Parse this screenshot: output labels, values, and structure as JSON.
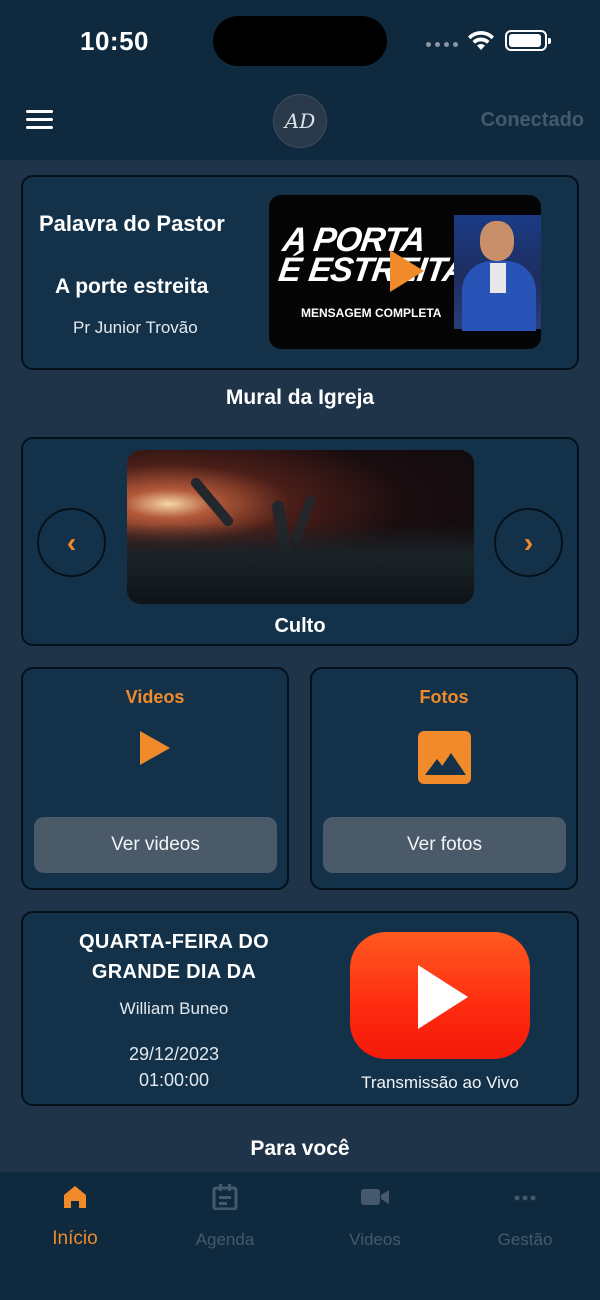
{
  "status_bar": {
    "time": "10:50"
  },
  "header": {
    "logo_text": "AD",
    "connection_status": "Conectado"
  },
  "pastor_card": {
    "title": "Palavra do Pastor",
    "sermon_title": "A porte estreita",
    "pastor_name": "Pr Junior Trovão",
    "thumbnail_headline_1": "A PORTA",
    "thumbnail_headline_2": "É ESTREITA",
    "thumbnail_caption": "MENSAGEM COMPLETA"
  },
  "mural": {
    "section_title": "Mural da Igreja",
    "current_label": "Culto",
    "prev_label": "‹",
    "next_label": "›"
  },
  "videos_card": {
    "title": "Videos",
    "button_label": "Ver videos"
  },
  "fotos_card": {
    "title": "Fotos",
    "button_label": "Ver fotos"
  },
  "live_card": {
    "title_line_1": "QUARTA-FEIRA DO",
    "title_line_2": "GRANDE DIA DA",
    "person": "William Buneo",
    "date": "29/12/2023",
    "time": "01:00:00",
    "stream_label": "Transmissão ao Vivo"
  },
  "for_you": {
    "section_title": "Para você"
  },
  "bottom_nav": {
    "tabs": [
      {
        "label": "Início",
        "icon": "home-icon",
        "active": true
      },
      {
        "label": "Agenda",
        "icon": "calendar-icon",
        "active": false
      },
      {
        "label": "Videos",
        "icon": "video-camera-icon",
        "active": false
      },
      {
        "label": "Gestão",
        "icon": "more-icon",
        "active": false
      }
    ]
  },
  "colors": {
    "accent": "#f08a2b",
    "background": "#1f3448",
    "card": "#133249",
    "bar": "#0f2a3f",
    "inactive": "#46596c",
    "youtube_red": "#ff2a10"
  }
}
